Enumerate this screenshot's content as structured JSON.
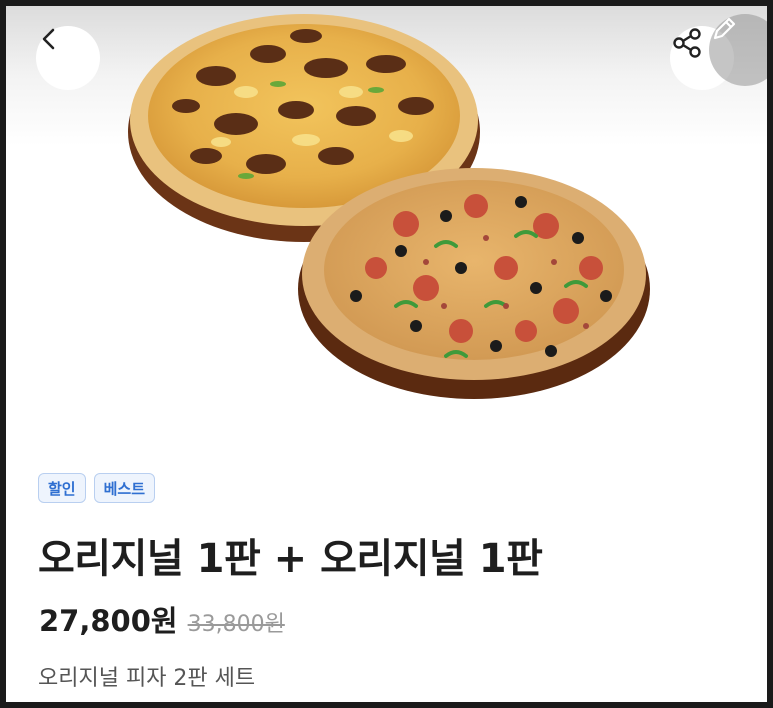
{
  "header": {
    "back_icon": "chevron-left-icon",
    "share_icon": "share-icon",
    "edit_icon": "pencil-icon"
  },
  "hero": {
    "image": "two-pizzas-product-photo"
  },
  "product": {
    "badges": [
      "할인",
      "베스트"
    ],
    "title": "오리지널 1판 + 오리지널 1판",
    "price": "27,800원",
    "original_price": "33,800원",
    "subtitle": "오리지널 피자 2판 세트"
  },
  "colors": {
    "badge_text": "#2f6fd1",
    "badge_bg": "#eef4fd",
    "title": "#1e1e1e",
    "strike_price": "#9a9a9a"
  }
}
